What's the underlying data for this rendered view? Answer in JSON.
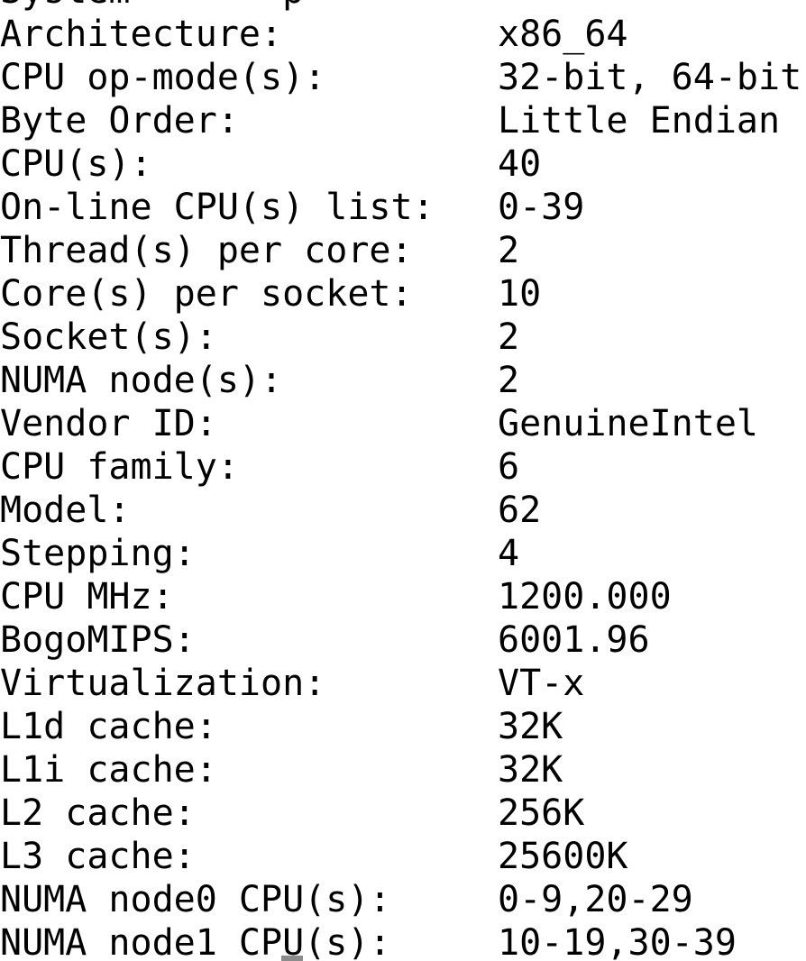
{
  "terminal": {
    "partial_top_line": "System       p",
    "rows": [
      {
        "label": "Architecture:",
        "value": "x86_64"
      },
      {
        "label": "CPU op-mode(s):",
        "value": "32-bit, 64-bit"
      },
      {
        "label": "Byte Order:",
        "value": "Little Endian"
      },
      {
        "label": "CPU(s):",
        "value": "40"
      },
      {
        "label": "On-line CPU(s) list:",
        "value": "0-39"
      },
      {
        "label": "Thread(s) per core:",
        "value": "2"
      },
      {
        "label": "Core(s) per socket:",
        "value": "10"
      },
      {
        "label": "Socket(s):",
        "value": "2"
      },
      {
        "label": "NUMA node(s):",
        "value": "2"
      },
      {
        "label": "Vendor ID:",
        "value": "GenuineIntel"
      },
      {
        "label": "CPU family:",
        "value": "6"
      },
      {
        "label": "Model:",
        "value": "62"
      },
      {
        "label": "Stepping:",
        "value": "4"
      },
      {
        "label": "CPU MHz:",
        "value": "1200.000"
      },
      {
        "label": "BogoMIPS:",
        "value": "6001.96"
      },
      {
        "label": "Virtualization:",
        "value": "VT-x"
      },
      {
        "label": "L1d cache:",
        "value": "32K"
      },
      {
        "label": "L1i cache:",
        "value": "32K"
      },
      {
        "label": "L2 cache:",
        "value": "256K"
      },
      {
        "label": "L3 cache:",
        "value": "25600K"
      },
      {
        "label": "NUMA node0 CPU(s):",
        "value": "0-9,20-29"
      },
      {
        "label": "NUMA node1 CPU(s):",
        "value": "10-19,30-39"
      }
    ]
  },
  "colors": {
    "background": "#ffffff",
    "text": "#000000",
    "cursor": "#8c8c8c"
  }
}
